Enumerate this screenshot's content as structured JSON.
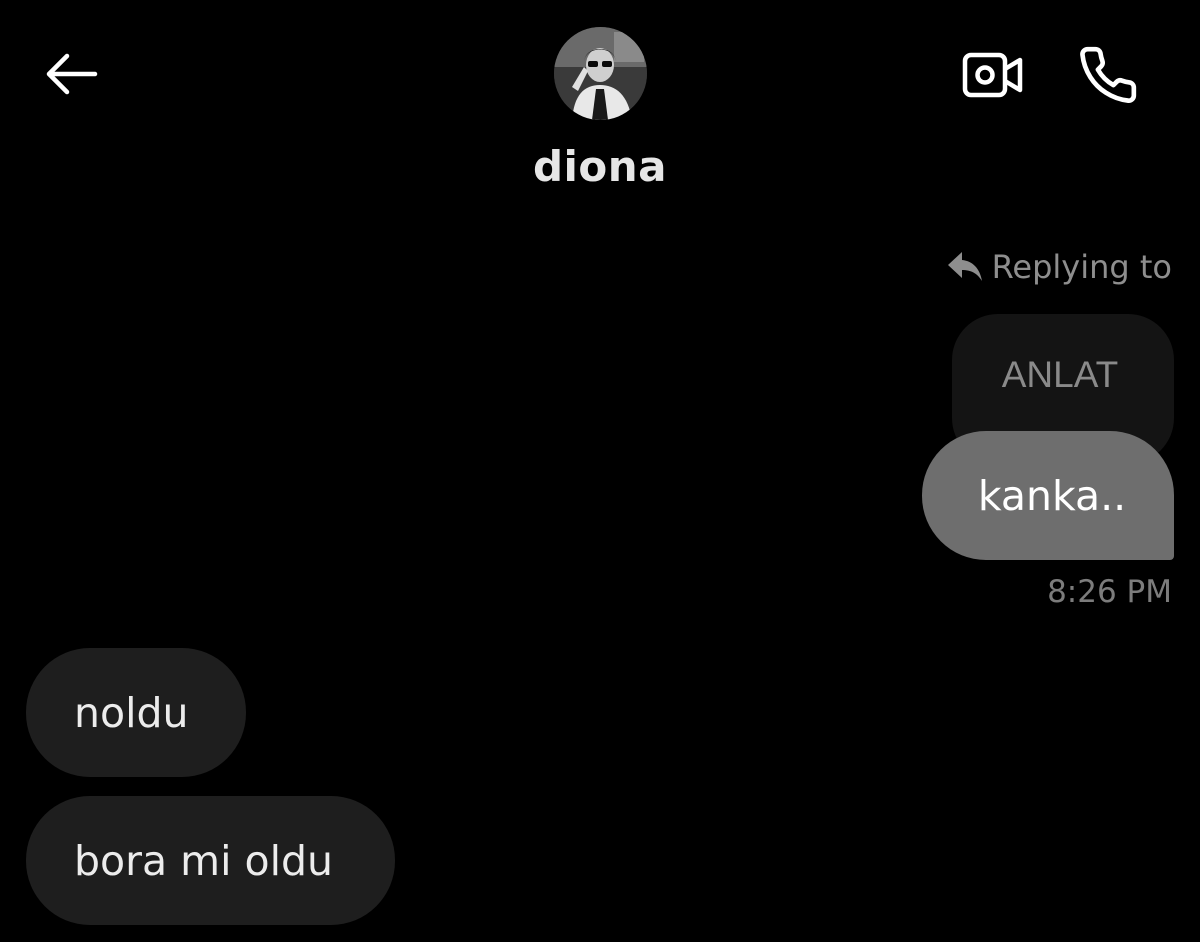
{
  "header": {
    "contact_name": "diona",
    "icons": {
      "back": "arrow-left-icon",
      "video": "video-camera-icon",
      "call": "phone-icon"
    }
  },
  "messages": {
    "reply_label": "Replying to",
    "quoted_text": "ANLAT",
    "sent_text": "kanka..",
    "sent_time": "8:26 PM",
    "received": [
      {
        "text": "noldu"
      },
      {
        "text": "bora mi oldu"
      }
    ]
  },
  "colors": {
    "background": "#000000",
    "sent_bubble": "#6e6e6e",
    "received_bubble": "#1e1e1e",
    "quoted_bubble": "#141414",
    "muted_text": "#8e8e8e"
  }
}
